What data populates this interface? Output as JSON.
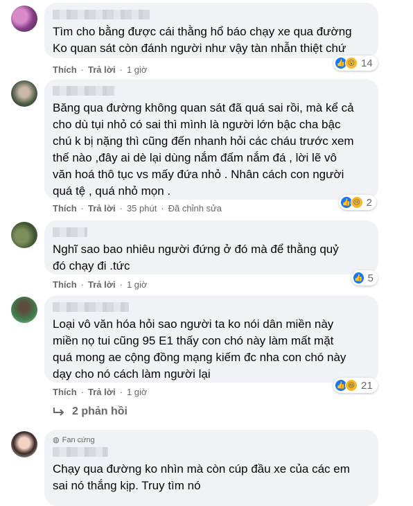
{
  "comments": [
    {
      "text": "Tìm cho bằng được cái thằng hổ báo chạy xe qua đường\nKo quan sát còn đánh người như vậy tàn nhẫn thiệt chứ",
      "like_label": "Thích",
      "reply_label": "Trả lời",
      "time": "1 giờ",
      "edited": "",
      "reaction_count": "14",
      "reaction_icons": [
        "like-icon",
        "wow-icon"
      ]
    },
    {
      "text": "Băng qua đường không quan sát đã quá sai rồi, mà kể cả\ncho dù tụi nhỏ có sai thì mình là người lớn bậc cha bậc\nchú k bị nặng thì cũng đến nhanh hỏi các cháu trước xem\nthế nào ,đây ai dè lại dùng nắm đấm nắm đá , lời lẽ vô\nvăn hoá thô tục vs mấy đứa nhỏ . Nhân cách con người\nquá tệ , quá nhỏ mọn .",
      "like_label": "Thích",
      "reply_label": "Trả lời",
      "time": "35 phút",
      "edited": "Đã chỉnh sửa",
      "reaction_count": "2",
      "reaction_icons": [
        "like-icon",
        "sad-icon"
      ]
    },
    {
      "text": "Nghĩ sao bao nhiêu người đứng ở đó mà để thằng quỷ\nđó chạy đi .tức",
      "like_label": "Thích",
      "reply_label": "Trả lời",
      "time": "1 giờ",
      "edited": "",
      "reaction_count": "5",
      "reaction_icons": [
        "like-icon"
      ]
    },
    {
      "text": "Loại vô văn hóa hỏi sao người ta ko nói dân miền này\nmiền nọ tui cũng 95 E1 thấy con chó này làm mất mặt\nquá mong ae cộng đồng mạng kiếm đc nha con chó này\ndạy cho nó cách làm người lại",
      "like_label": "Thích",
      "reply_label": "Trả lời",
      "time": "1 giờ",
      "edited": "",
      "reaction_count": "21",
      "reaction_icons": [
        "like-icon",
        "haha-icon"
      ]
    },
    {
      "badge": "Fan cứng",
      "text": "Chạy qua đường ko nhìn mà còn cúp đầu xe của các em\nsai nó thắng kịp. Truy tìm nó"
    }
  ],
  "replies_label": "2 phản hồi",
  "colors": {
    "bubble": "#f0f2f5",
    "meta": "#65676b",
    "like_blue": "#1877f2",
    "emoji_yellow": "#f7b928"
  }
}
